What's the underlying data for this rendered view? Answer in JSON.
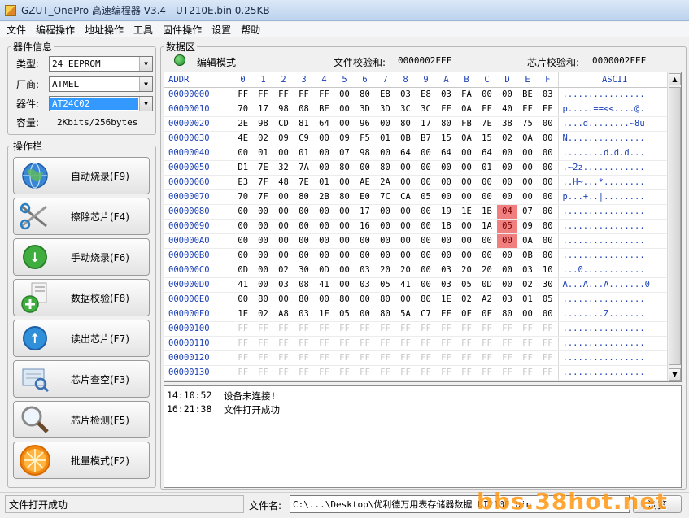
{
  "window": {
    "title": "GZUT_OnePro 高速编程器 V3.4 - UT210E.bin  0.25KB"
  },
  "menu": [
    "文件",
    "编程操作",
    "地址操作",
    "工具",
    "固件操作",
    "设置",
    "帮助"
  ],
  "device_info": {
    "legend": "器件信息",
    "type_label": "类型:",
    "type_value": "24 EEPROM",
    "vendor_label": "厂商:",
    "vendor_value": "ATMEL",
    "device_label": "器件:",
    "device_value": "AT24C02",
    "capacity_label": "容量:",
    "capacity_value": "2Kbits/256bytes"
  },
  "operations": {
    "legend": "操作栏",
    "buttons": [
      {
        "label": "自动烧录(F9)",
        "icon": "globe-icon"
      },
      {
        "label": "擦除芯片(F4)",
        "icon": "scissors-icon"
      },
      {
        "label": "手动烧录(F6)",
        "icon": "download-arrow-icon"
      },
      {
        "label": "数据校验(F8)",
        "icon": "verify-plus-icon"
      },
      {
        "label": "读出芯片(F7)",
        "icon": "upload-arrow-icon"
      },
      {
        "label": "芯片查空(F3)",
        "icon": "blank-check-icon"
      },
      {
        "label": "芯片检测(F5)",
        "icon": "magnifier-icon"
      },
      {
        "label": "批量模式(F2)",
        "icon": "orange-slice-icon"
      }
    ]
  },
  "data_area": {
    "legend": "数据区",
    "mode": "编辑模式",
    "file_checksum_label": "文件校验和:",
    "file_checksum": "0000002FEF",
    "chip_checksum_label": "芯片校验和:",
    "chip_checksum": "0000002FEF",
    "colors": {
      "status_led": "#1e8a2a",
      "highlight": "#f08080"
    }
  },
  "hex": {
    "header_addr": "ADDR",
    "header_cols": [
      "0",
      "1",
      "2",
      "3",
      "4",
      "5",
      "6",
      "7",
      "8",
      "9",
      "A",
      "B",
      "C",
      "D",
      "E",
      "F"
    ],
    "header_ascii": "ASCII",
    "rows": [
      {
        "addr": "00000000",
        "bytes": [
          "FF",
          "FF",
          "FF",
          "FF",
          "FF",
          "00",
          "80",
          "E8",
          "03",
          "E8",
          "03",
          "FA",
          "00",
          "00",
          "BE",
          "03"
        ],
        "ascii": "................"
      },
      {
        "addr": "00000010",
        "bytes": [
          "70",
          "17",
          "98",
          "08",
          "BE",
          "00",
          "3D",
          "3D",
          "3C",
          "3C",
          "FF",
          "0A",
          "FF",
          "40",
          "FF",
          "FF"
        ],
        "ascii": "p.....==<<....@."
      },
      {
        "addr": "00000020",
        "bytes": [
          "2E",
          "98",
          "CD",
          "81",
          "64",
          "00",
          "96",
          "00",
          "80",
          "17",
          "80",
          "FB",
          "7E",
          "38",
          "75",
          "00"
        ],
        "ascii": "....d........~8u"
      },
      {
        "addr": "00000030",
        "bytes": [
          "4E",
          "02",
          "09",
          "C9",
          "00",
          "09",
          "F5",
          "01",
          "0B",
          "B7",
          "15",
          "0A",
          "15",
          "02",
          "0A",
          "00"
        ],
        "ascii": "N..............."
      },
      {
        "addr": "00000040",
        "bytes": [
          "00",
          "01",
          "00",
          "01",
          "00",
          "07",
          "98",
          "00",
          "64",
          "00",
          "64",
          "00",
          "64",
          "00",
          "00",
          "00"
        ],
        "ascii": "........d.d.d..."
      },
      {
        "addr": "00000050",
        "bytes": [
          "D1",
          "7E",
          "32",
          "7A",
          "00",
          "80",
          "00",
          "80",
          "00",
          "00",
          "00",
          "00",
          "01",
          "00",
          "00",
          "00"
        ],
        "ascii": ".~2z............"
      },
      {
        "addr": "00000060",
        "bytes": [
          "E3",
          "7F",
          "48",
          "7E",
          "01",
          "00",
          "AE",
          "2A",
          "00",
          "00",
          "00",
          "00",
          "00",
          "00",
          "00",
          "00"
        ],
        "ascii": "..H~...*........"
      },
      {
        "addr": "00000070",
        "bytes": [
          "70",
          "7F",
          "00",
          "80",
          "2B",
          "80",
          "E0",
          "7C",
          "CA",
          "05",
          "00",
          "00",
          "00",
          "00",
          "00",
          "00"
        ],
        "ascii": "p...+..|........"
      },
      {
        "addr": "00000080",
        "bytes": [
          "00",
          "00",
          "00",
          "00",
          "00",
          "00",
          "17",
          "00",
          "00",
          "00",
          "19",
          "1E",
          "1B",
          "04",
          "07",
          "00"
        ],
        "ascii": "................"
      },
      {
        "addr": "00000090",
        "bytes": [
          "00",
          "00",
          "00",
          "00",
          "00",
          "00",
          "16",
          "00",
          "00",
          "00",
          "18",
          "00",
          "1A",
          "05",
          "09",
          "00"
        ],
        "ascii": "................"
      },
      {
        "addr": "000000A0",
        "bytes": [
          "00",
          "00",
          "00",
          "00",
          "00",
          "00",
          "00",
          "00",
          "00",
          "00",
          "00",
          "00",
          "00",
          "00",
          "0A",
          "00"
        ],
        "ascii": "................"
      },
      {
        "addr": "000000B0",
        "bytes": [
          "00",
          "00",
          "00",
          "00",
          "00",
          "00",
          "00",
          "00",
          "00",
          "00",
          "00",
          "00",
          "00",
          "00",
          "0B",
          "00"
        ],
        "ascii": "................"
      },
      {
        "addr": "000000C0",
        "bytes": [
          "0D",
          "00",
          "02",
          "30",
          "0D",
          "00",
          "03",
          "20",
          "20",
          "00",
          "03",
          "20",
          "20",
          "00",
          "03",
          "10"
        ],
        "ascii": "...0............"
      },
      {
        "addr": "000000D0",
        "bytes": [
          "41",
          "00",
          "03",
          "08",
          "41",
          "00",
          "03",
          "05",
          "41",
          "00",
          "03",
          "05",
          "0D",
          "00",
          "02",
          "30"
        ],
        "ascii": "A...A...A.......0"
      },
      {
        "addr": "000000E0",
        "bytes": [
          "00",
          "80",
          "00",
          "80",
          "00",
          "80",
          "00",
          "80",
          "00",
          "80",
          "1E",
          "02",
          "A2",
          "03",
          "01",
          "05"
        ],
        "ascii": "................"
      },
      {
        "addr": "000000F0",
        "bytes": [
          "1E",
          "02",
          "A8",
          "03",
          "1F",
          "05",
          "00",
          "80",
          "5A",
          "C7",
          "EF",
          "0F",
          "0F",
          "80",
          "00",
          "00"
        ],
        "ascii": "........Z......."
      },
      {
        "addr": "00000100",
        "bytes": [
          "FF",
          "FF",
          "FF",
          "FF",
          "FF",
          "FF",
          "FF",
          "FF",
          "FF",
          "FF",
          "FF",
          "FF",
          "FF",
          "FF",
          "FF",
          "FF"
        ],
        "ascii": "................"
      },
      {
        "addr": "00000110",
        "bytes": [
          "FF",
          "FF",
          "FF",
          "FF",
          "FF",
          "FF",
          "FF",
          "FF",
          "FF",
          "FF",
          "FF",
          "FF",
          "FF",
          "FF",
          "FF",
          "FF"
        ],
        "ascii": "................"
      },
      {
        "addr": "00000120",
        "bytes": [
          "FF",
          "FF",
          "FF",
          "FF",
          "FF",
          "FF",
          "FF",
          "FF",
          "FF",
          "FF",
          "FF",
          "FF",
          "FF",
          "FF",
          "FF",
          "FF"
        ],
        "ascii": "................"
      },
      {
        "addr": "00000130",
        "bytes": [
          "FF",
          "FF",
          "FF",
          "FF",
          "FF",
          "FF",
          "FF",
          "FF",
          "FF",
          "FF",
          "FF",
          "FF",
          "FF",
          "FF",
          "FF",
          "FF"
        ],
        "ascii": "................"
      }
    ],
    "highlighted": [
      [
        8,
        13
      ],
      [
        9,
        13
      ],
      [
        10,
        13
      ]
    ]
  },
  "log": [
    {
      "time": "14:10:52",
      "msg": "设备未连接!"
    },
    {
      "time": "16:21:38",
      "msg": "文件打开成功"
    }
  ],
  "status": {
    "left_text": "文件打开成功",
    "filename_label": "文件名:",
    "filename_value": "C:\\...\\Desktop\\优利德万用表存储器数据 UT210E.bin",
    "browse_label": "浏览"
  },
  "watermark": "bbs.38hot.net"
}
